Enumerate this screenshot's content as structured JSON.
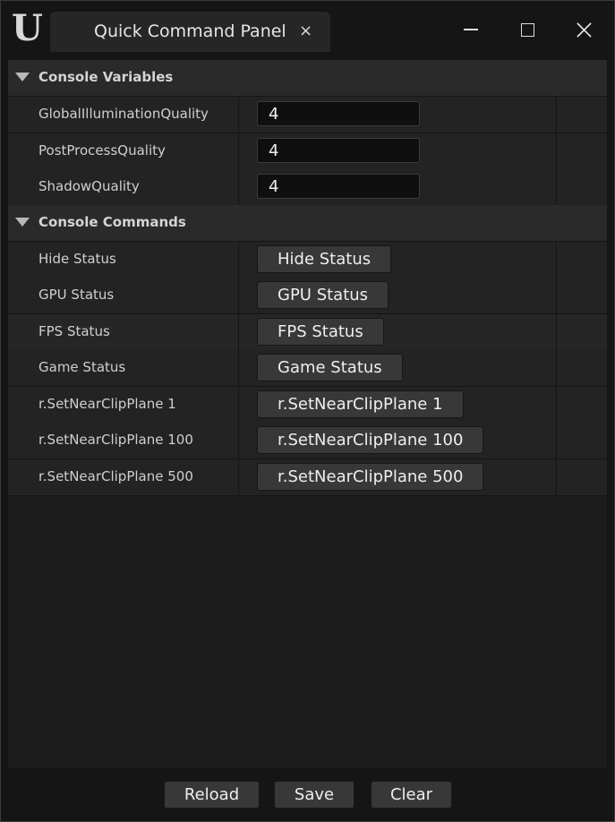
{
  "window": {
    "tab_title": "Quick Command Panel",
    "tab_close_glyph": "×",
    "logo_glyph": "U"
  },
  "sections": {
    "variables": {
      "label": "Console Variables"
    },
    "commands": {
      "label": "Console Commands"
    }
  },
  "variables": [
    {
      "label": "GlobalIlluminationQuality",
      "value": "4"
    },
    {
      "label": "PostProcessQuality",
      "value": "4"
    },
    {
      "label": "ShadowQuality",
      "value": "4"
    }
  ],
  "commands": [
    {
      "label": "Hide Status",
      "button": "Hide Status"
    },
    {
      "label": "GPU Status",
      "button": "GPU Status"
    },
    {
      "label": "FPS Status",
      "button": "FPS Status"
    },
    {
      "label": "Game Status",
      "button": "Game Status"
    },
    {
      "label": "r.SetNearClipPlane 1",
      "button": "r.SetNearClipPlane 1"
    },
    {
      "label": "r.SetNearClipPlane 100",
      "button": "r.SetNearClipPlane 100"
    },
    {
      "label": "r.SetNearClipPlane 500",
      "button": "r.SetNearClipPlane 500"
    }
  ],
  "footer": {
    "reload": "Reload",
    "save": "Save",
    "clear": "Clear"
  },
  "colors": {
    "background": "#151515",
    "panel": "#1c1c1c",
    "row": "#232323",
    "section_row": "#2a2a2a",
    "button": "#383838",
    "input": "#0f0f0f"
  }
}
